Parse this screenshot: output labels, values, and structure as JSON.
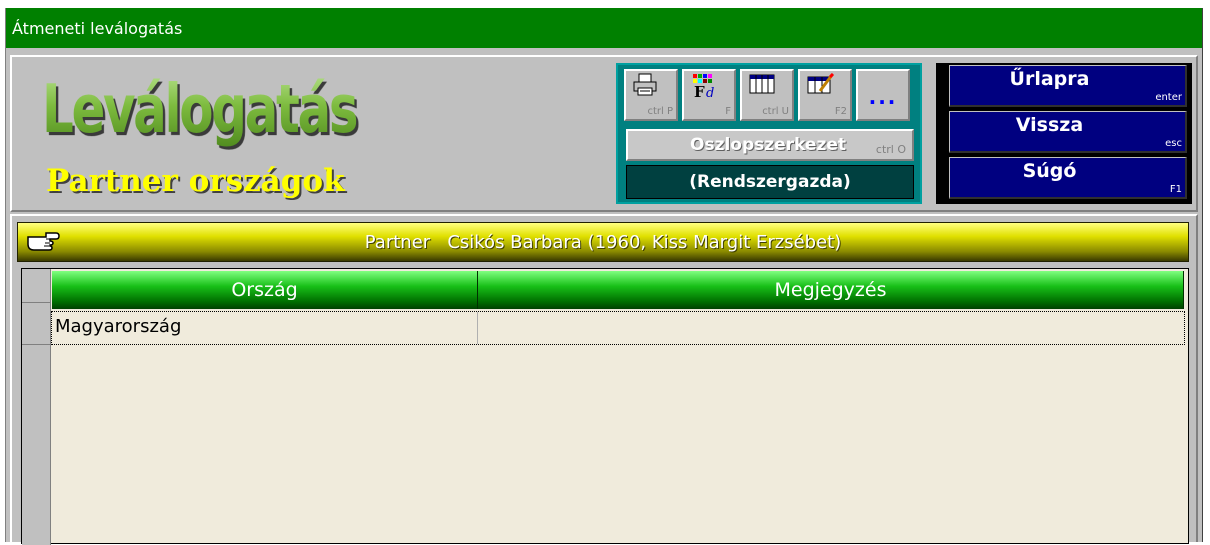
{
  "window": {
    "title": "Átmeneti leválogatás"
  },
  "header": {
    "big_title": "Leválogatás",
    "subtitle": "Partner országok"
  },
  "toolbar": {
    "icons": [
      {
        "icon": "printer-icon",
        "hotkey": "ctrl P"
      },
      {
        "icon": "color-font-icon",
        "hotkey": "F"
      },
      {
        "icon": "columns-icon",
        "hotkey": "ctrl U"
      },
      {
        "icon": "edit-grid-icon",
        "hotkey": "F2"
      },
      {
        "icon": "more-icon",
        "label": "..."
      }
    ],
    "column_structure": {
      "label": "Oszlopszerkezet",
      "hotkey": "ctrl O"
    },
    "user": "(Rendszergazda)"
  },
  "nav": {
    "form": {
      "label": "Űrlapra",
      "hotkey": "enter"
    },
    "back": {
      "label": "Vissza",
      "hotkey": "esc"
    },
    "help": {
      "label": "Súgó",
      "hotkey": "F1"
    }
  },
  "partner_bar": {
    "text": "Partner   Csikós Barbara (1960, Kiss Margit Erzsébet)"
  },
  "grid": {
    "columns": [
      "Ország",
      "Megjegyzés"
    ],
    "rows": [
      [
        "Magyarország",
        ""
      ]
    ]
  },
  "colors": {
    "titlebar": "#008000",
    "nav_button": "#000080",
    "toolbar_bg": "#008080",
    "grid_bg": "#f0ebdc",
    "subtitle": "#ffff00"
  }
}
